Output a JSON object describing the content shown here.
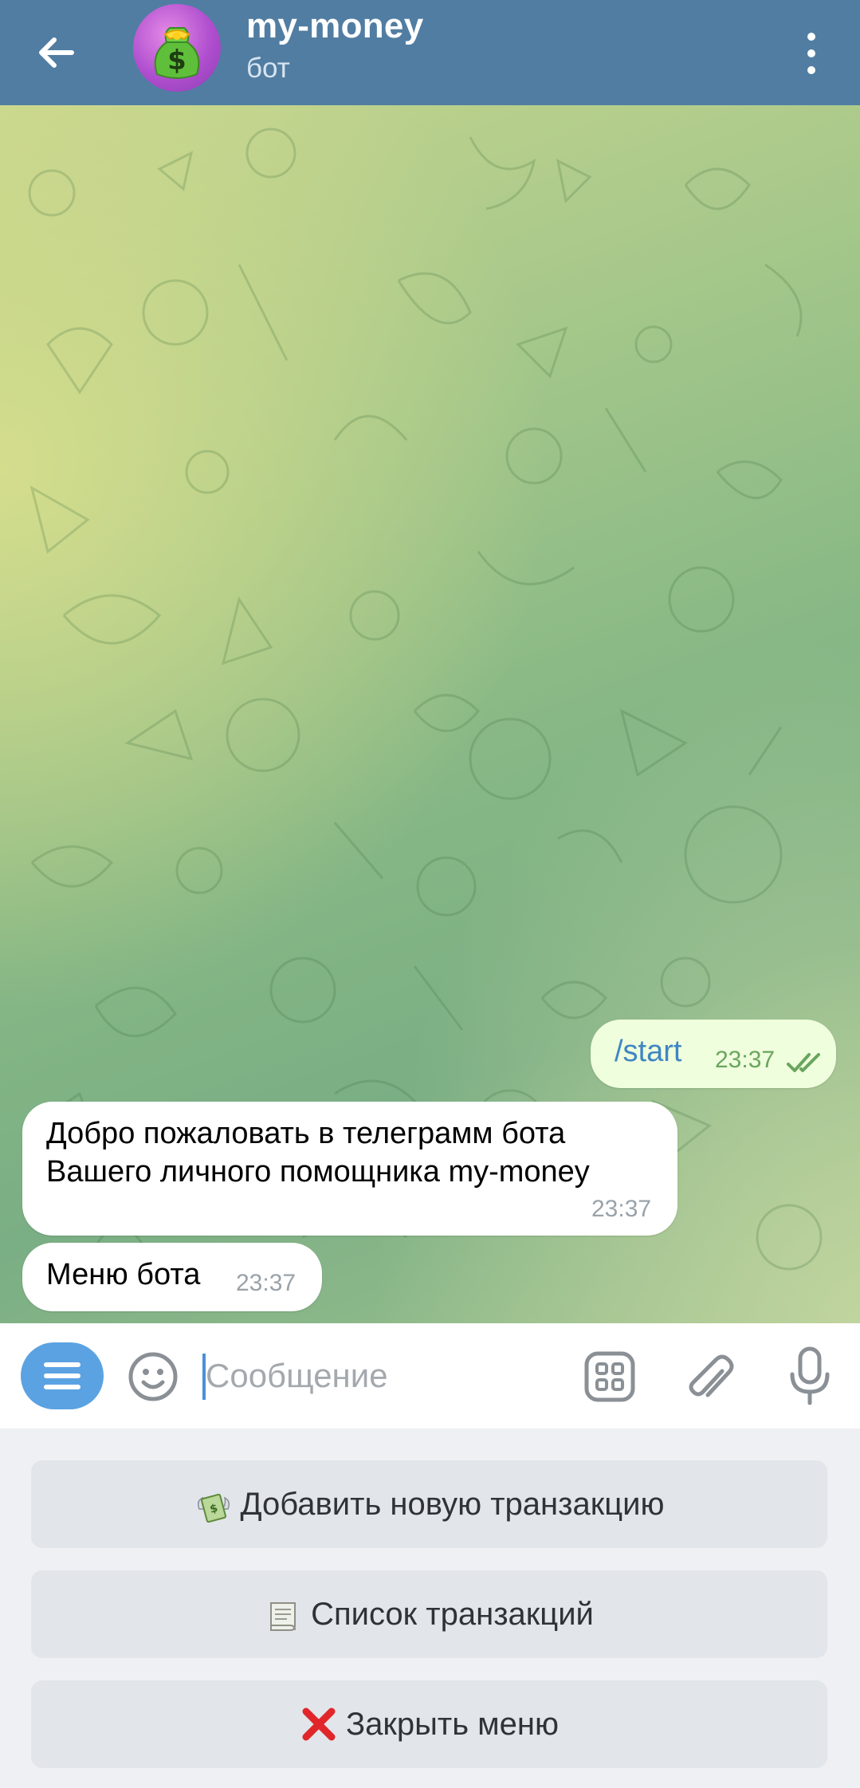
{
  "header": {
    "title": "my-money",
    "subtitle": "бот",
    "back_icon": "arrow-left-icon",
    "menu_icon": "more-vertical-icon",
    "avatar_icon": "money-bag-icon",
    "background_color": "#517da2"
  },
  "chat": {
    "messages": [
      {
        "direction": "outgoing",
        "lines": [
          "/start"
        ],
        "time": "23:37",
        "status_icon": "double-check-icon"
      },
      {
        "direction": "incoming",
        "lines": [
          "Добро пожаловать в телеграмм бота",
          "Вашего личного помощника my-money"
        ],
        "time": "23:37"
      },
      {
        "direction": "incoming",
        "lines": [
          "Меню бота"
        ],
        "time": "23:37"
      }
    ]
  },
  "input": {
    "placeholder": "Сообщение",
    "value": "",
    "menu_button_icon": "hamburger-icon",
    "emoji_icon": "smile-icon",
    "stickers_icon": "apps-grid-icon",
    "attach_icon": "paperclip-icon",
    "mic_icon": "microphone-icon"
  },
  "keyboard": {
    "buttons": [
      {
        "emoji": "money-with-wings-icon",
        "label": "Добавить новую транзакцию"
      },
      {
        "emoji": "scroll-icon",
        "label": "Список транзакций"
      },
      {
        "emoji": "cross-mark-icon",
        "label": "Закрыть меню"
      }
    ]
  },
  "colors": {
    "accent": "#5ba2e2",
    "outgoing_bubble": "#effedd",
    "incoming_bubble": "#ffffff",
    "keyboard_button": "#e2e5e9"
  }
}
